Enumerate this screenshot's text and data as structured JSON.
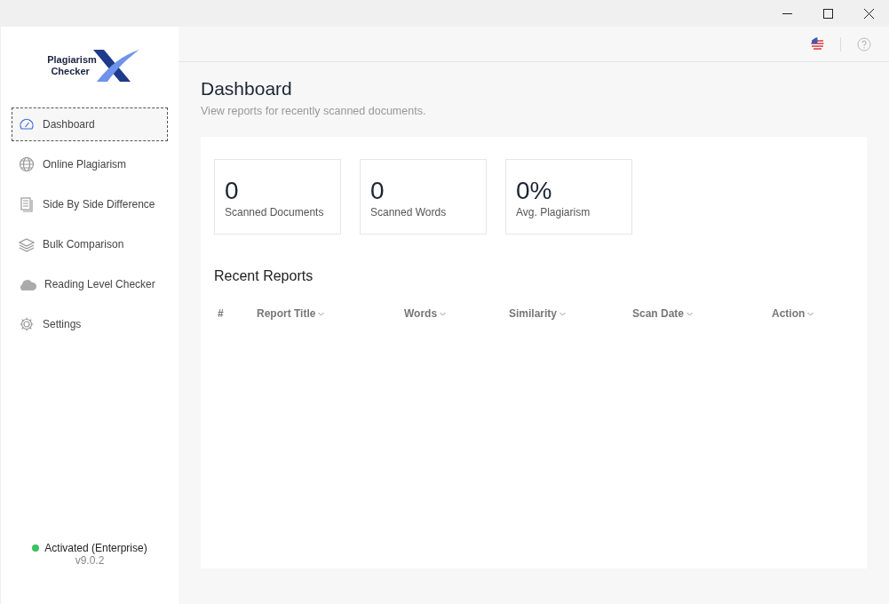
{
  "logo": {
    "line_1": "Plagiarism",
    "line_2": "Checker"
  },
  "sidebar": {
    "items": [
      {
        "label": "Dashboard",
        "kind": "gauge",
        "selected": true
      },
      {
        "label": "Online Plagiarism",
        "kind": "globe",
        "selected": false
      },
      {
        "label": "Side By Side Difference",
        "kind": "document",
        "selected": false
      },
      {
        "label": "Bulk Comparison",
        "kind": "layers",
        "selected": false
      },
      {
        "label": "Reading Level Checker",
        "kind": "cloud",
        "selected": false
      },
      {
        "label": "Settings",
        "kind": "gear",
        "selected": false
      }
    ],
    "status": {
      "label": "Activated (Enterprise)",
      "color": "#3cc164"
    },
    "version": "v9.0.2"
  },
  "page": {
    "title": "Dashboard",
    "subtitle": "View reports for recently scanned documents."
  },
  "stats": [
    {
      "value": "0",
      "label": "Scanned Documents"
    },
    {
      "value": "0",
      "label": "Scanned Words"
    },
    {
      "value": "0%",
      "label": "Avg. Plagiarism"
    }
  ],
  "table": {
    "title": "Recent Reports",
    "columns": [
      {
        "label": "#",
        "sortable": false
      },
      {
        "label": "Report Title",
        "sortable": true
      },
      {
        "label": "Words",
        "sortable": true
      },
      {
        "label": "Similarity",
        "sortable": true
      },
      {
        "label": "Scan Date",
        "sortable": true
      },
      {
        "label": "Action",
        "sortable": true
      }
    ]
  }
}
